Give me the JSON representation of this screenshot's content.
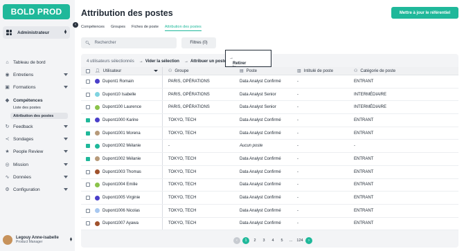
{
  "brand": {
    "logo": "BOLD PROD",
    "accent": "#1fb89a"
  },
  "sidebar": {
    "role": "Administrateur",
    "items": [
      {
        "label": "Tableau de bord",
        "icon": "home-icon",
        "glyph": "⌂",
        "expandable": false
      },
      {
        "label": "Entretiens",
        "icon": "chat-icon",
        "glyph": "◉",
        "expandable": true
      },
      {
        "label": "Formations",
        "icon": "grad-cap-icon",
        "glyph": "▣",
        "expandable": true
      },
      {
        "label": "Compétences",
        "icon": "skills-icon",
        "glyph": "◆",
        "expandable": false,
        "active": true
      },
      {
        "label": "Feedback",
        "icon": "refresh-icon",
        "glyph": "↻",
        "expandable": true
      },
      {
        "label": "Sondages",
        "icon": "share-icon",
        "glyph": "≺",
        "expandable": true
      },
      {
        "label": "People Review",
        "icon": "star-icon",
        "glyph": "★",
        "expandable": true
      },
      {
        "label": "Mission",
        "icon": "target-icon",
        "glyph": "◎",
        "expandable": true
      },
      {
        "label": "Données",
        "icon": "chart-icon",
        "glyph": "∿",
        "expandable": true
      },
      {
        "label": "Configuration",
        "icon": "gear-icon",
        "glyph": "⚙",
        "expandable": true
      }
    ],
    "subitems": [
      {
        "label": "Liste des postes",
        "selected": false
      },
      {
        "label": "Attribution des postes",
        "selected": true
      }
    ],
    "user": {
      "name": "Legouy Anne-isabelle",
      "role": "Product Manager"
    }
  },
  "header": {
    "title": "Attribution des postes",
    "cta_label": "Mettre à jour le référentiel",
    "tabs": [
      "Compétences",
      "Groupes",
      "Fiches de poste",
      "Attribution des postes"
    ],
    "active_tab": 3
  },
  "toolbar": {
    "search_placeholder": "Rechercher",
    "filters_label": "Filtres (0)"
  },
  "bulk": {
    "selection_text": "4 utilisateurs sélectionnés",
    "actions": [
      "Vider la sélection",
      "Attribuer un poste",
      "Retirer le poste"
    ]
  },
  "table": {
    "columns": [
      "Utilisateur",
      "Groupe",
      "Poste",
      "Intitulé de poste",
      "Catégorie de poste"
    ],
    "rows": [
      {
        "checked": false,
        "name": "Dupont1 Romain",
        "av": "#4a3fc9",
        "group": "PARIS, OPÉRATIONS",
        "poste": "Data Analyst Confirmé",
        "intitule": "-",
        "cat": "ENTRANT"
      },
      {
        "checked": false,
        "name": "Dupont10 Isabelle",
        "av": "#7fd3e0",
        "group": "PARIS, OPÉRATIONS",
        "poste": "Data Analyst Senior",
        "intitule": "-",
        "cat": "INTERMÉDIAIRE"
      },
      {
        "checked": false,
        "name": "Dupont100 Laurence",
        "av": "#8bc34a",
        "group": "PARIS, OPÉRATIONS",
        "poste": "Data Analyst Senior",
        "intitule": "-",
        "cat": "INTERMÉDIAIRE"
      },
      {
        "checked": true,
        "name": "Dupont1000 Karine",
        "av": "#4a3fc9",
        "group": "TOKYO, TECH",
        "poste": "Data Analyst Confirmé",
        "intitule": "-",
        "cat": "ENTRANT"
      },
      {
        "checked": true,
        "name": "Dupont1001 Morena",
        "av": "#b79a7a",
        "group": "TOKYO, TECH",
        "poste": "Data Analyst Confirmé",
        "intitule": "-",
        "cat": "ENTRANT"
      },
      {
        "checked": true,
        "name": "Dupont1002 Mélanie",
        "av": "#1fb89a",
        "group": "-",
        "poste": "Aucun poste",
        "intitule": "-",
        "cat": "-",
        "italic": true
      },
      {
        "checked": true,
        "name": "Dupont1002 Mélanie",
        "av": "#b79a7a",
        "group": "TOKYO, TECH",
        "poste": "Data Analyst Confirmé",
        "intitule": "-",
        "cat": "ENTRANT"
      },
      {
        "checked": false,
        "name": "Dupont1003 Thomas",
        "av": "#a0522d",
        "group": "TOKYO, TECH",
        "poste": "Data Analyst Confirmé",
        "intitule": "-",
        "cat": "ENTRANT"
      },
      {
        "checked": false,
        "name": "Dupont1004 Emilie",
        "av": "#8bc34a",
        "group": "TOKYO, TECH",
        "poste": "Data Analyst Confirmé",
        "intitule": "-",
        "cat": "ENTRANT"
      },
      {
        "checked": false,
        "name": "Dupont1005 Virginie",
        "av": "#4a3fc9",
        "group": "TOKYO, TECH",
        "poste": "Data Analyst Confirmé",
        "intitule": "-",
        "cat": "ENTRANT"
      },
      {
        "checked": false,
        "name": "Dupont1006 Nicolas",
        "av": "#a8c8f0",
        "group": "TOKYO, TECH",
        "poste": "Data Analyst Confirmé",
        "intitule": "-",
        "cat": "ENTRANT"
      },
      {
        "checked": false,
        "name": "Dupont1007 Ayawa",
        "av": "#a0522d",
        "group": "TOKYO, TECH",
        "poste": "Data Analyst Confirmé",
        "intitule": "-",
        "cat": "ENTRANT"
      }
    ]
  },
  "pagination": {
    "pages": [
      "1",
      "2",
      "3",
      "4",
      "5",
      "...",
      "124"
    ],
    "current": "1"
  }
}
